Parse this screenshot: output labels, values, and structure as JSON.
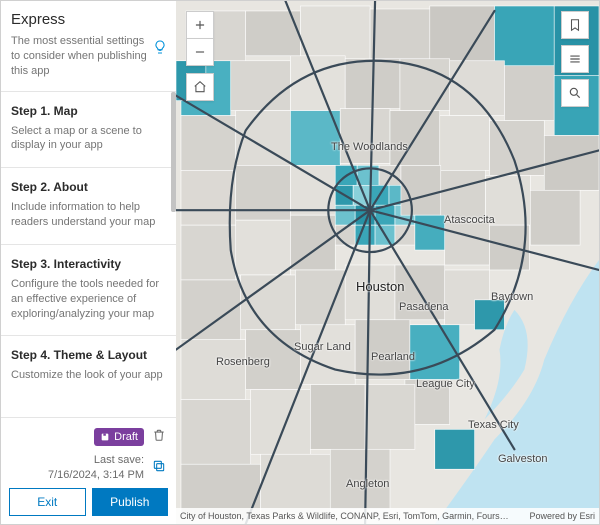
{
  "sidebar": {
    "title": "Express",
    "subtitle": "The most essential settings to consider when publishing this app",
    "steps": [
      {
        "title": "Step 1. Map",
        "desc": "Select a map or a scene to display in your app"
      },
      {
        "title": "Step 2. About",
        "desc": "Include information to help readers understand your map"
      },
      {
        "title": "Step 3. Interactivity",
        "desc": "Configure the tools needed for an effective experience of exploring/analyzing your map"
      },
      {
        "title": "Step 4. Theme & Layout",
        "desc": "Customize the look of your app"
      }
    ],
    "footer": {
      "draft_label": "Draft",
      "last_save_label": "Last save:",
      "last_save_value": "7/16/2024, 3:14 PM",
      "exit_label": "Exit",
      "publish_label": "Publish"
    }
  },
  "map": {
    "labels": {
      "main": "Houston",
      "woodlands": "The Woodlands",
      "atascocita": "Atascocita",
      "pasadena": "Pasadena",
      "baytown": "Baytown",
      "sugarland": "Sugar Land",
      "pearland": "Pearland",
      "rosenberg": "Rosenberg",
      "leaguecity": "League City",
      "texascity": "Texas City",
      "galveston": "Galveston",
      "angleton": "Angleton"
    },
    "attribution_left": "City of Houston, Texas Parks & Wildlife, CONANP, Esri, TomTom, Garmin, Fours…",
    "attribution_right": "Powered by Esri"
  }
}
